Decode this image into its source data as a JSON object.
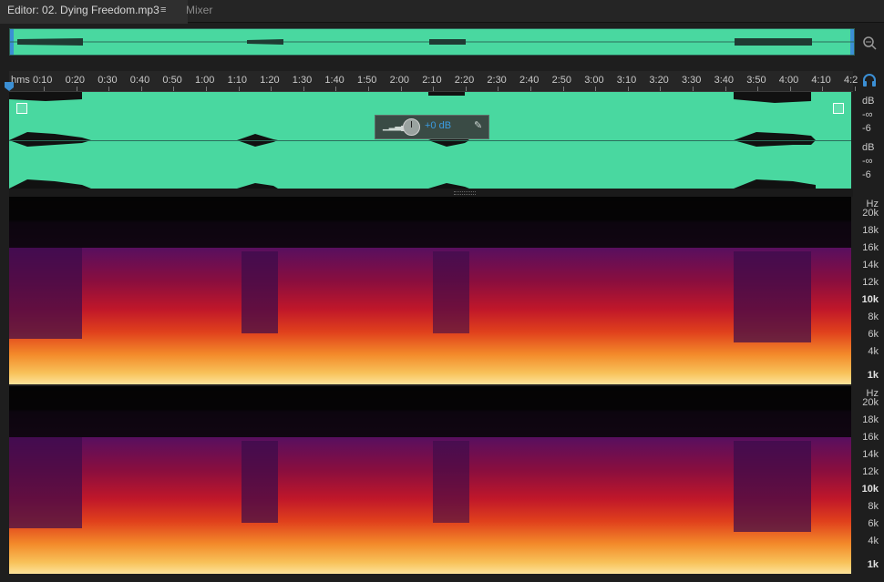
{
  "tabs": {
    "editor_label": "Editor: 02. Dying Freedom.mp3",
    "menu_glyph": "≡",
    "mixer_label": "Mixer"
  },
  "ruler": {
    "unit": "hms",
    "ticks": [
      "0:10",
      "0:20",
      "0:30",
      "0:40",
      "0:50",
      "1:00",
      "1:10",
      "1:20",
      "1:30",
      "1:40",
      "1:50",
      "2:00",
      "2:10",
      "2:20",
      "2:30",
      "2:40",
      "2:50",
      "3:00",
      "3:10",
      "3:20",
      "3:30",
      "3:40",
      "3:50",
      "4:00",
      "4:10",
      "4:2"
    ]
  },
  "hud": {
    "volume": "+0 dB"
  },
  "db_scale": {
    "top": {
      "unit": "dB",
      "inf": "-∞",
      "six": "-6"
    },
    "bottom": {
      "unit": "dB",
      "inf": "-∞",
      "six": "-6"
    }
  },
  "hz_scale": {
    "unit": "Hz",
    "labels": [
      "20k",
      "18k",
      "16k",
      "14k",
      "12k",
      "10k",
      "8k",
      "6k",
      "4k",
      "1k"
    ]
  },
  "colors": {
    "waveform": "#49d8a0",
    "accent": "#3b8fd4"
  },
  "icons": [
    "menu-icon",
    "zoom-icon",
    "headphone-icon",
    "volume-icon",
    "pin-icon",
    "playhead-icon"
  ]
}
